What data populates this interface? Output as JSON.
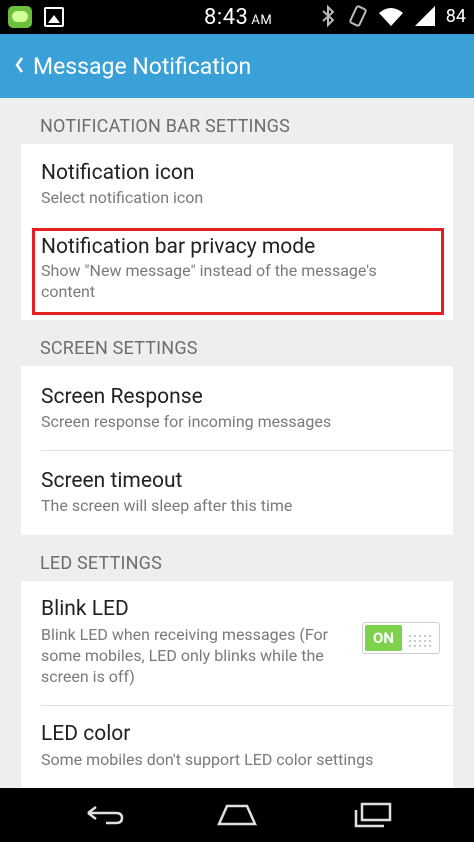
{
  "status_bar": {
    "time": "8:43",
    "ampm": "AM",
    "battery": "84"
  },
  "action_bar": {
    "title": "Message Notification"
  },
  "sections": {
    "notification_bar": {
      "header": "NOTIFICATION BAR SETTINGS",
      "items": [
        {
          "title": "Notification icon",
          "subtitle": "Select notification icon"
        },
        {
          "title": "Notification bar privacy mode",
          "subtitle_line1": "Show \"New message\" instead of the message's",
          "subtitle_line2": "content"
        }
      ]
    },
    "screen": {
      "header": "SCREEN SETTINGS",
      "items": [
        {
          "title": "Screen Response",
          "subtitle": "Screen response for incoming messages"
        },
        {
          "title": "Screen timeout",
          "subtitle": "The screen will sleep after this time"
        }
      ]
    },
    "led": {
      "header": "LED SETTINGS",
      "items": [
        {
          "title": "Blink LED",
          "subtitle_line1": "Blink LED when receiving messages (For",
          "subtitle_line2": "some mobiles, LED only blinks while the",
          "subtitle_line3": "screen is off)",
          "toggle_label": "ON",
          "toggle_state": true
        },
        {
          "title": "LED color",
          "subtitle": "Some mobiles don't support LED color settings"
        }
      ]
    }
  },
  "colors": {
    "action_bar": "#3aa0d8",
    "toggle_on": "#7ed14a",
    "highlight_box": "#e31e24"
  },
  "icons": [
    "app-notification-icon",
    "image-icon",
    "bluetooth-icon",
    "vibrate-icon",
    "wifi-icon",
    "signal-icon",
    "back-chevron-icon",
    "nav-back-icon",
    "nav-home-icon",
    "nav-recents-icon"
  ]
}
